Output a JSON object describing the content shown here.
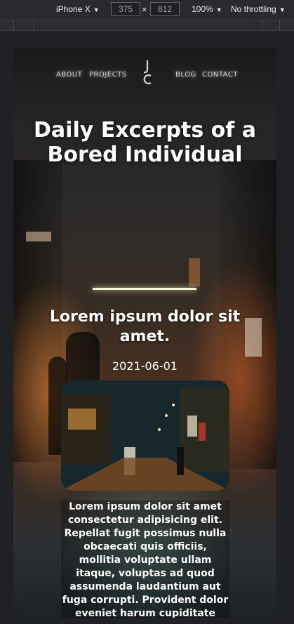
{
  "devtools": {
    "device": "iPhone X",
    "width": "375",
    "separator": "×",
    "height": "812",
    "zoom": "100%",
    "throttling": "No throttling"
  },
  "nav": {
    "items": [
      "ABOUT",
      "PROJECTS",
      "BLOG",
      "CONTACT"
    ],
    "logo_icon": "jc-monogram-logo"
  },
  "hero": {
    "title": "Daily Excerpts of a Bored Individual"
  },
  "post": {
    "title": "Lorem ipsum dolor sit amet.",
    "date": "2021-06-01",
    "image_icon": "night-alley-photo",
    "body": "Lorem ipsum dolor sit amet consectetur adipisicing elit. Repellat fugit possimus nulla obcaecati quis officiis, mollitia voluptate ullam itaque, voluptas ad quod assumenda laudantium aut fuga corrupti. Provident dolor eveniet harum cupiditate debitis velit fuga distinctio"
  }
}
